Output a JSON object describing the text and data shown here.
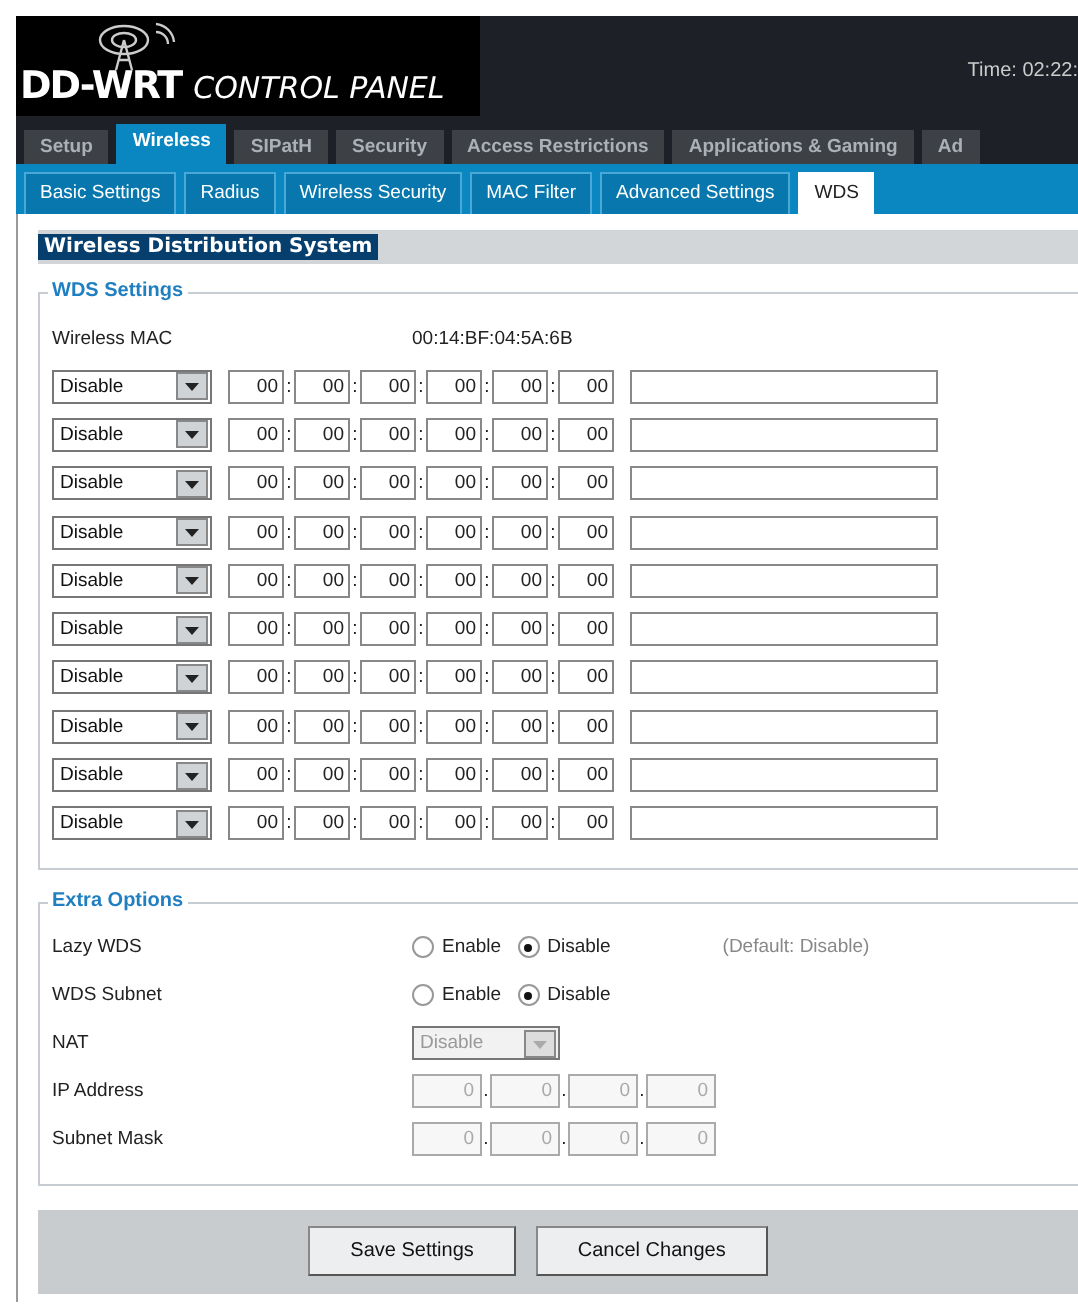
{
  "header": {
    "brand": "DD-WRT",
    "subtitle": "CONTROL PANEL",
    "time": "Time: 02:22:"
  },
  "main_tabs": [
    {
      "label": "Setup",
      "selected": false
    },
    {
      "label": "Wireless",
      "selected": true
    },
    {
      "label": "SIPatH",
      "selected": false
    },
    {
      "label": "Security",
      "selected": false
    },
    {
      "label": "Access Restrictions",
      "selected": false
    },
    {
      "label": "Applications & Gaming",
      "selected": false
    },
    {
      "label": "Ad",
      "selected": false
    }
  ],
  "sub_tabs": [
    {
      "label": "Basic Settings",
      "selected": false
    },
    {
      "label": "Radius",
      "selected": false
    },
    {
      "label": "Wireless Security",
      "selected": false
    },
    {
      "label": "MAC Filter",
      "selected": false
    },
    {
      "label": "Advanced Settings",
      "selected": false
    },
    {
      "label": "WDS",
      "selected": true
    }
  ],
  "section_title": "Wireless Distribution System",
  "wds_settings": {
    "legend": "WDS Settings",
    "mac_label": "Wireless MAC",
    "mac_value": "00:14:BF:04:5A:6B",
    "rows": [
      {
        "mode": "Disable",
        "mac": [
          {
            "value": "00",
            "sep": ":"
          },
          {
            "value": "00",
            "sep": ":"
          },
          {
            "value": "00",
            "sep": ":"
          },
          {
            "value": "00",
            "sep": ":"
          },
          {
            "value": "00",
            "sep": ":"
          },
          {
            "value": "00"
          }
        ]
      },
      {
        "mode": "Disable",
        "mac": [
          {
            "value": "00",
            "sep": ":"
          },
          {
            "value": "00",
            "sep": ":"
          },
          {
            "value": "00",
            "sep": ":"
          },
          {
            "value": "00",
            "sep": ":"
          },
          {
            "value": "00",
            "sep": ":"
          },
          {
            "value": "00"
          }
        ]
      },
      {
        "mode": "Disable",
        "mac": [
          {
            "value": "00",
            "sep": ":"
          },
          {
            "value": "00",
            "sep": ":"
          },
          {
            "value": "00",
            "sep": ":"
          },
          {
            "value": "00",
            "sep": ":"
          },
          {
            "value": "00",
            "sep": ":"
          },
          {
            "value": "00"
          }
        ]
      },
      {
        "mode": "Disable",
        "mac": [
          {
            "value": "00",
            "sep": ":"
          },
          {
            "value": "00",
            "sep": ":"
          },
          {
            "value": "00",
            "sep": ":"
          },
          {
            "value": "00",
            "sep": ":"
          },
          {
            "value": "00",
            "sep": ":"
          },
          {
            "value": "00"
          }
        ]
      },
      {
        "mode": "Disable",
        "mac": [
          {
            "value": "00",
            "sep": ":"
          },
          {
            "value": "00",
            "sep": ":"
          },
          {
            "value": "00",
            "sep": ":"
          },
          {
            "value": "00",
            "sep": ":"
          },
          {
            "value": "00",
            "sep": ":"
          },
          {
            "value": "00"
          }
        ]
      },
      {
        "mode": "Disable",
        "mac": [
          {
            "value": "00",
            "sep": ":"
          },
          {
            "value": "00",
            "sep": ":"
          },
          {
            "value": "00",
            "sep": ":"
          },
          {
            "value": "00",
            "sep": ":"
          },
          {
            "value": "00",
            "sep": ":"
          },
          {
            "value": "00"
          }
        ]
      },
      {
        "mode": "Disable",
        "mac": [
          {
            "value": "00",
            "sep": ":"
          },
          {
            "value": "00",
            "sep": ":"
          },
          {
            "value": "00",
            "sep": ":"
          },
          {
            "value": "00",
            "sep": ":"
          },
          {
            "value": "00",
            "sep": ":"
          },
          {
            "value": "00"
          }
        ]
      },
      {
        "mode": "Disable",
        "mac": [
          {
            "value": "00",
            "sep": ":"
          },
          {
            "value": "00",
            "sep": ":"
          },
          {
            "value": "00",
            "sep": ":"
          },
          {
            "value": "00",
            "sep": ":"
          },
          {
            "value": "00",
            "sep": ":"
          },
          {
            "value": "00"
          }
        ]
      },
      {
        "mode": "Disable",
        "mac": [
          {
            "value": "00",
            "sep": ":"
          },
          {
            "value": "00",
            "sep": ":"
          },
          {
            "value": "00",
            "sep": ":"
          },
          {
            "value": "00",
            "sep": ":"
          },
          {
            "value": "00",
            "sep": ":"
          },
          {
            "value": "00"
          }
        ]
      },
      {
        "mode": "Disable",
        "mac": [
          {
            "value": "00",
            "sep": ":"
          },
          {
            "value": "00",
            "sep": ":"
          },
          {
            "value": "00",
            "sep": ":"
          },
          {
            "value": "00",
            "sep": ":"
          },
          {
            "value": "00",
            "sep": ":"
          },
          {
            "value": "00"
          }
        ]
      }
    ]
  },
  "extra_options": {
    "legend": "Extra Options",
    "rows": [
      {
        "kind": "radio",
        "label": "Lazy WDS",
        "options": [
          {
            "label": "Enable",
            "selected": false
          },
          {
            "label": "Disable",
            "selected": true
          }
        ],
        "note": "(Default: Disable)"
      },
      {
        "kind": "radio",
        "label": "WDS Subnet",
        "options": [
          {
            "label": "Enable",
            "selected": false
          },
          {
            "label": "Disable",
            "selected": true
          }
        ]
      },
      {
        "kind": "select",
        "label": "NAT",
        "value": "Disable",
        "disabled": true
      },
      {
        "kind": "ip",
        "label": "IP Address",
        "octets": [
          {
            "value": "0",
            "sep": "."
          },
          {
            "value": "0",
            "sep": "."
          },
          {
            "value": "0",
            "sep": "."
          },
          {
            "value": "0"
          }
        ],
        "disabled": true
      },
      {
        "kind": "ip",
        "label": "Subnet Mask",
        "octets": [
          {
            "value": "0",
            "sep": "."
          },
          {
            "value": "0",
            "sep": "."
          },
          {
            "value": "0",
            "sep": "."
          },
          {
            "value": "0"
          }
        ],
        "disabled": true
      }
    ]
  },
  "buttons": [
    "Save Settings",
    "Cancel Changes"
  ]
}
